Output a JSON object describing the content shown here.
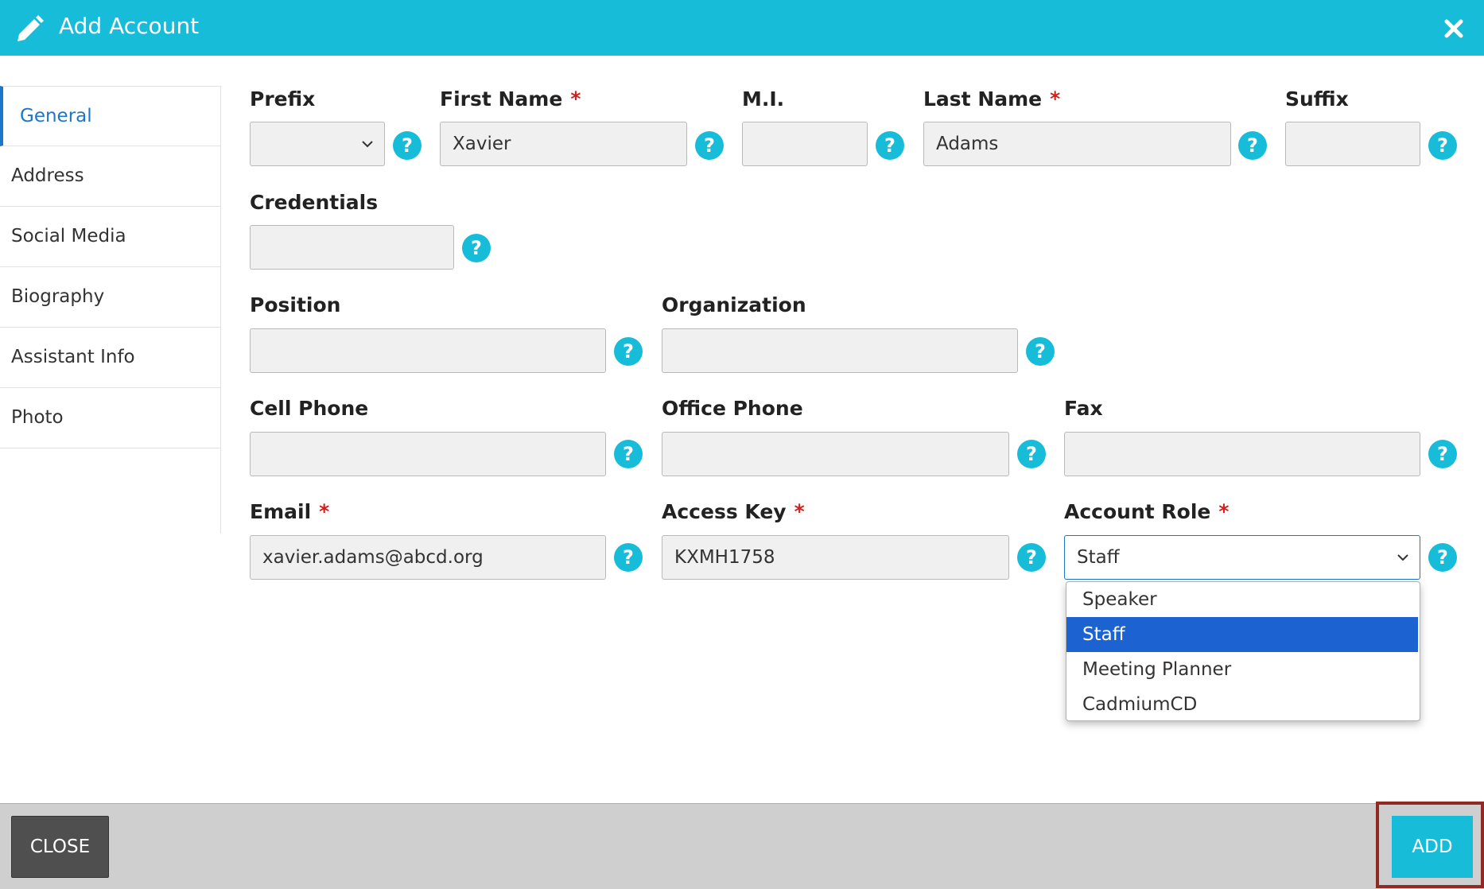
{
  "header": {
    "title": "Add Account",
    "icon": "pencil-icon",
    "close_icon": "close-icon"
  },
  "sidebar": {
    "items": [
      {
        "label": "General",
        "active": true
      },
      {
        "label": "Address"
      },
      {
        "label": "Social Media"
      },
      {
        "label": "Biography"
      },
      {
        "label": "Assistant Info"
      },
      {
        "label": "Photo"
      }
    ]
  },
  "form": {
    "prefix": {
      "label": "Prefix",
      "value": ""
    },
    "first_name": {
      "label": "First Name",
      "value": "Xavier"
    },
    "mi": {
      "label": "M.I.",
      "value": ""
    },
    "last_name": {
      "label": "Last Name",
      "value": "Adams"
    },
    "suffix": {
      "label": "Suffix",
      "value": ""
    },
    "credentials": {
      "label": "Credentials",
      "value": ""
    },
    "position": {
      "label": "Position",
      "value": ""
    },
    "organization": {
      "label": "Organization",
      "value": ""
    },
    "cell_phone": {
      "label": "Cell Phone",
      "value": ""
    },
    "office_phone": {
      "label": "Office Phone",
      "value": ""
    },
    "fax": {
      "label": "Fax",
      "value": ""
    },
    "email": {
      "label": "Email",
      "value": "xavier.adams@abcd.org"
    },
    "access_key": {
      "label": "Access Key",
      "value": "KXMH1758"
    },
    "account_role": {
      "label": "Account Role",
      "value": "Staff",
      "options": [
        "Speaker",
        "Staff",
        "Meeting Planner",
        "CadmiumCD"
      ]
    },
    "required_mark": "*",
    "help_glyph": "?"
  },
  "footer": {
    "close_label": "CLOSE",
    "add_label": "ADD"
  },
  "colors": {
    "accent": "#17bcd9",
    "active_link": "#1c76c9",
    "required": "#d0201c",
    "selected_option": "#1c62d0",
    "highlight_border": "#8e2b23"
  }
}
